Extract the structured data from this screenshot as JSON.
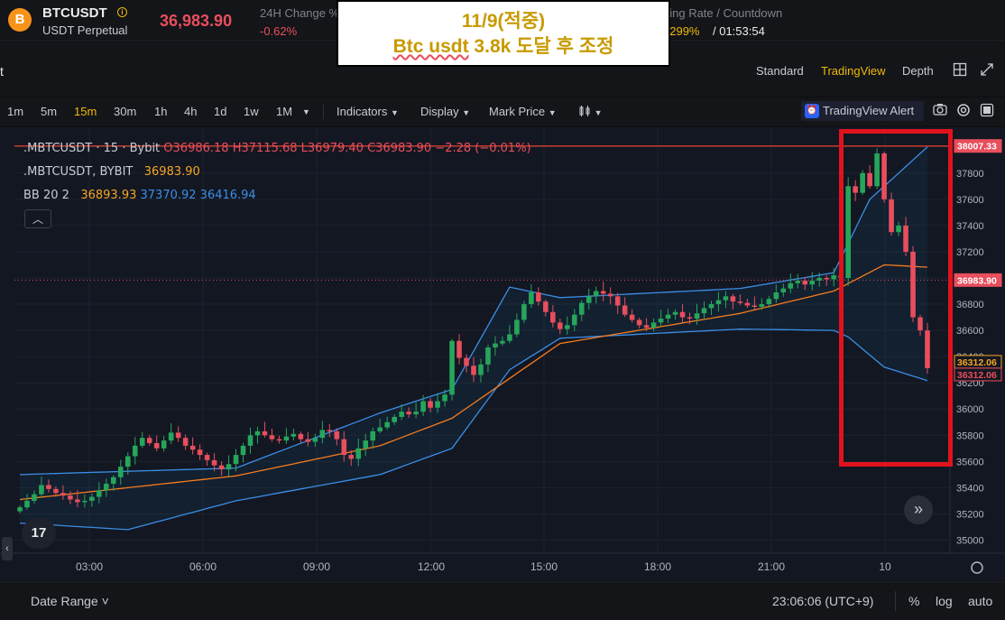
{
  "ticker": {
    "coin_icon": "bitcoin-icon",
    "coin_glyph": "B",
    "symbol": "BTCUSDT",
    "info_glyph": "i",
    "contract_type": "USDT Perpetual",
    "last_price": "36,983.90",
    "change_label": "24H Change %",
    "change_value": "-0.62%",
    "funding_label": "ding Rate / Countdown",
    "funding_rate": "0299%",
    "countdown": " / 01:53:54"
  },
  "annotation": {
    "line1": "11/9(적중)",
    "line2_underlined": "Btc usdt",
    "line2_rest": " 3.8k 도달 후 조정"
  },
  "view_row": {
    "cut_label": "t",
    "tabs": [
      "Standard",
      "TradingView",
      "Depth"
    ],
    "active_tab": "TradingView",
    "icons": [
      "grid-layout-icon",
      "expand-icon"
    ]
  },
  "toolbar": {
    "timeframes": [
      "1m",
      "5m",
      "15m",
      "30m",
      "1h",
      "4h",
      "1d",
      "1w",
      "1M"
    ],
    "active_timeframe": "15m",
    "menus": [
      "Indicators",
      "Display",
      "Mark Price"
    ],
    "tv_alert_label": "TradingView Alert",
    "icons": [
      "candle-type-icon",
      "camera-icon",
      "settings-icon",
      "fullscreen-icon"
    ]
  },
  "legend": {
    "main_prefix": ".MBTCUSDT · 15 · Bybit",
    "open": "O36986.18",
    "high": "H37115.68",
    "low": "L36979.40",
    "close": "C36983.90",
    "change": "−2.28 (−0.01%)",
    "mark_label": ".MBTCUSDT, BYBIT",
    "mark_value": "36983.90",
    "bb_label": "BB 20 2",
    "bb_basis": "36893.93",
    "bb_upper": "37370.92",
    "bb_lower": "36416.94"
  },
  "chart_widgets": {
    "collapse_glyph": "︿",
    "tv_logo": "17",
    "scroll_glyph": "»",
    "left_glyph": "‹"
  },
  "bottom": {
    "date_range": "Date Range ˅",
    "clock": "23:06:06 (UTC+9)",
    "options": [
      "%",
      "log",
      "auto"
    ]
  },
  "chart_data": {
    "type": "candlestick",
    "x_ticks": [
      "03:00",
      "06:00",
      "09:00",
      "12:00",
      "15:00",
      "18:00",
      "21:00",
      "10"
    ],
    "y_ticks": [
      38000,
      37800,
      37600,
      37400,
      37200,
      37000,
      36800,
      36600,
      36400,
      36200,
      36000,
      35800,
      35600,
      35400,
      35200,
      35000
    ],
    "ylim": [
      34900,
      38150
    ],
    "price_tags": [
      {
        "value": "38007.33",
        "color": "#e84e5d",
        "filled": true
      },
      {
        "value": "36983.90",
        "color": "#e84e5d",
        "filled": true
      },
      {
        "value": "36312.06",
        "color": "#f5a623",
        "filled": false
      },
      {
        "value": "36312.06",
        "color": "#e84e5d",
        "filled": false
      }
    ],
    "horizontal_line": 38007.33,
    "current_price_line": 36983.9,
    "up_color": "#26a65b",
    "down_color": "#e84e5d",
    "series_closes": [
      35250,
      35300,
      35350,
      35420,
      35390,
      35360,
      35340,
      35310,
      35290,
      35300,
      35330,
      35380,
      35430,
      35480,
      35560,
      35640,
      35720,
      35780,
      35740,
      35700,
      35760,
      35820,
      35780,
      35720,
      35690,
      35650,
      35610,
      35570,
      35540,
      35580,
      35650,
      35720,
      35800,
      35830,
      35800,
      35770,
      35760,
      35790,
      35810,
      35770,
      35750,
      35780,
      35840,
      35830,
      35770,
      35650,
      35620,
      35700,
      35760,
      35830,
      35860,
      35900,
      35940,
      35980,
      35960,
      35980,
      36060,
      36010,
      36060,
      36110,
      36520,
      36390,
      36330,
      36260,
      36340,
      36470,
      36500,
      36520,
      36570,
      36680,
      36800,
      36890,
      36820,
      36740,
      36660,
      36610,
      36640,
      36720,
      36810,
      36860,
      36900,
      36880,
      36860,
      36790,
      36720,
      36680,
      36640,
      36620,
      36660,
      36690,
      36720,
      36740,
      36700,
      36690,
      36730,
      36770,
      36800,
      36830,
      36860,
      36820,
      36810,
      36790,
      36780,
      36800,
      36840,
      36890,
      36920,
      36960,
      36980,
      36950,
      36980,
      37000,
      36990,
      37020,
      37000,
      37700,
      37650,
      37800,
      37700,
      37950,
      37600,
      37350,
      37400,
      37200,
      36700,
      36600,
      36312
    ],
    "bb_upper_key_points": [
      [
        0,
        35500
      ],
      [
        30,
        35550
      ],
      [
        50,
        35970
      ],
      [
        60,
        36150
      ],
      [
        68,
        36930
      ],
      [
        75,
        36850
      ],
      [
        100,
        36920
      ],
      [
        113,
        37040
      ],
      [
        118,
        37600
      ],
      [
        127,
        38050
      ]
    ],
    "bb_basis_key_points": [
      [
        0,
        35310
      ],
      [
        30,
        35490
      ],
      [
        50,
        35720
      ],
      [
        60,
        35930
      ],
      [
        75,
        36500
      ],
      [
        100,
        36730
      ],
      [
        113,
        36900
      ],
      [
        120,
        37100
      ],
      [
        127,
        37080
      ]
    ],
    "bb_lower_key_points": [
      [
        0,
        35130
      ],
      [
        15,
        35080
      ],
      [
        30,
        35300
      ],
      [
        50,
        35500
      ],
      [
        60,
        35700
      ],
      [
        68,
        36300
      ],
      [
        75,
        36540
      ],
      [
        100,
        36610
      ],
      [
        113,
        36600
      ],
      [
        115,
        36550
      ],
      [
        120,
        36320
      ],
      [
        127,
        36200
      ]
    ]
  }
}
